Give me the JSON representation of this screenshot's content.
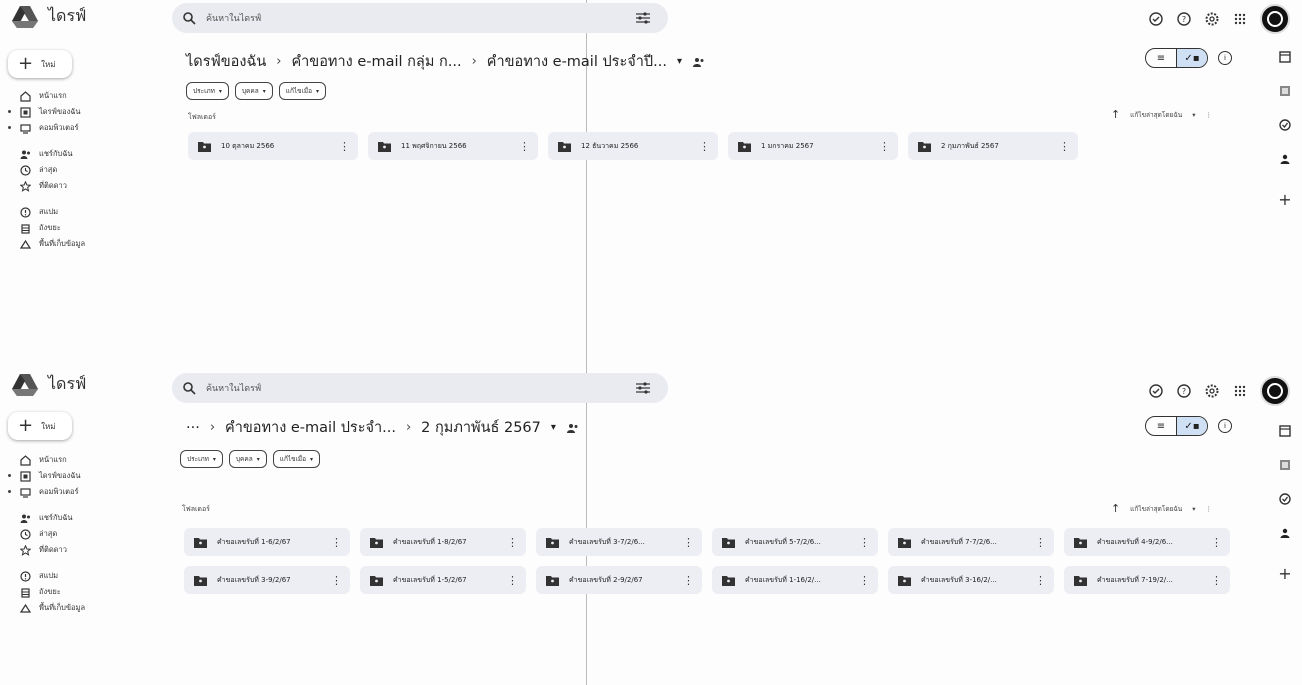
{
  "app_title": "ไดรฟ์",
  "search": {
    "placeholder": "ค้นหาในไดรฟ์"
  },
  "new_button": "ใหม่",
  "sidebar": {
    "items": [
      {
        "label": "หน้าแรก",
        "icon": "home-icon"
      },
      {
        "label": "ไดรฟ์ของฉัน",
        "icon": "my-drive-icon"
      },
      {
        "label": "คอมพิวเตอร์",
        "icon": "computer-icon"
      },
      {
        "label": "แชร์กับฉัน",
        "icon": "shared-icon"
      },
      {
        "label": "ล่าสุด",
        "icon": "clock-icon"
      },
      {
        "label": "ที่ติดดาว",
        "icon": "star-icon"
      },
      {
        "label": "สแปม",
        "icon": "spam-icon"
      },
      {
        "label": "ถังขยะ",
        "icon": "trash-icon"
      },
      {
        "label": "พื้นที่เก็บข้อมูล",
        "icon": "cloud-icon"
      }
    ]
  },
  "filters": {
    "type": "ประเภท",
    "people": "บุคคล",
    "modified": "แก้ไขเมื่อ"
  },
  "folders_label": "โฟลเดอร์",
  "sort_label": "แก้ไขล่าสุดโดยฉัน",
  "top_panel": {
    "breadcrumb": [
      "ไดรฟ์ของฉัน",
      "คำขอทาง e-mail กลุ่ม ก...",
      "คำขอทาง e-mail ประจำปี..."
    ],
    "folders": [
      "10 ตุลาคม 2566",
      "11 พฤศจิกายน 2566",
      "12 ธันวาคม 2566",
      "1 มกราคม 2567",
      "2 กุมภาพันธ์ 2567"
    ]
  },
  "bottom_panel": {
    "breadcrumb": [
      "···",
      "คำขอทาง e-mail ประจำ...",
      "2 กุมภาพันธ์ 2567"
    ],
    "folders_row1": [
      "คำขอเลขรับที่ 1-6/2/67",
      "คำขอเลขรับที่ 1-8/2/67",
      "คำขอเลขรับที่ 3-7/2/6...",
      "คำขอเลขรับที่ 5-7/2/6...",
      "คำขอเลขรับที่ 7-7/2/6...",
      "คำขอเลขรับที่ 4-9/2/6..."
    ],
    "folders_row2": [
      "คำขอเลขรับที่ 3-9/2/67",
      "คำขอเลขรับที่ 1-5/2/67",
      "คำขอเลขรับที่ 2-9/2/67",
      "คำขอเลขรับที่ 1-16/2/...",
      "คำขอเลขรับที่ 3-16/2/...",
      "คำขอเลขรับที่ 7-19/2/..."
    ]
  }
}
